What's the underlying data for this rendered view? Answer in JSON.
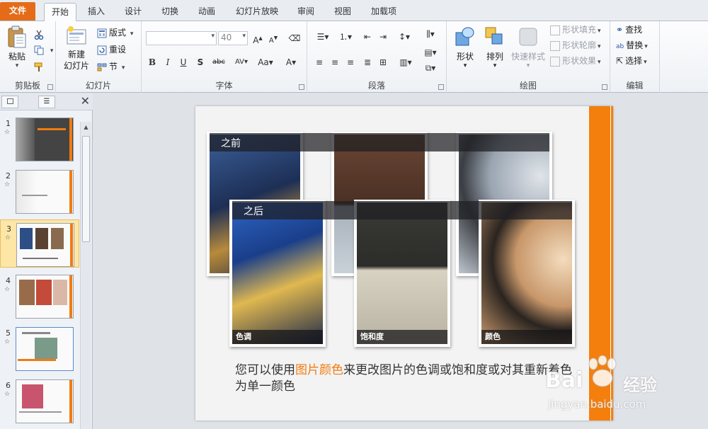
{
  "tabs": [
    "文件",
    "开始",
    "插入",
    "设计",
    "切换",
    "动画",
    "幻灯片放映",
    "审阅",
    "视图",
    "加载项"
  ],
  "ribbon": {
    "clipboard": {
      "label": "剪贴板",
      "paste": "粘贴"
    },
    "slides": {
      "label": "幻灯片",
      "new_slide": "新建\n幻灯片",
      "layout": "版式",
      "reset": "重设",
      "section": "节"
    },
    "font": {
      "label": "字体",
      "font_size": "40"
    },
    "paragraph": {
      "label": "段落"
    },
    "drawing": {
      "label": "绘图",
      "shapes": "形状",
      "arrange": "排列",
      "quick_styles": "快速样式",
      "shape_fill": "形状填充",
      "shape_outline": "形状轮廓",
      "shape_effects": "形状效果"
    },
    "editing": {
      "label": "编辑",
      "find": "查找",
      "replace": "替换",
      "select": "选择"
    }
  },
  "thumbnails": [
    {
      "num": "1"
    },
    {
      "num": "2"
    },
    {
      "num": "3",
      "selected": true
    },
    {
      "num": "4"
    },
    {
      "num": "5"
    },
    {
      "num": "6"
    }
  ],
  "slide": {
    "before_label": "之前",
    "after_label": "之后",
    "captions": [
      "色调",
      "饱和度",
      "颜色"
    ],
    "body_pre": "您可以使用",
    "body_highlight": "图片颜色",
    "body_post": "来更改图片的色调或饱和度或对其重新着色为单一颜色"
  },
  "watermark": {
    "brand": "Bai",
    "brand2": "经验",
    "url": "jingyan.baidu.com"
  },
  "colors": {
    "accent": "#f47f0c",
    "file_tab": "#e46c19",
    "selected_thumb": "#fde6a6"
  }
}
